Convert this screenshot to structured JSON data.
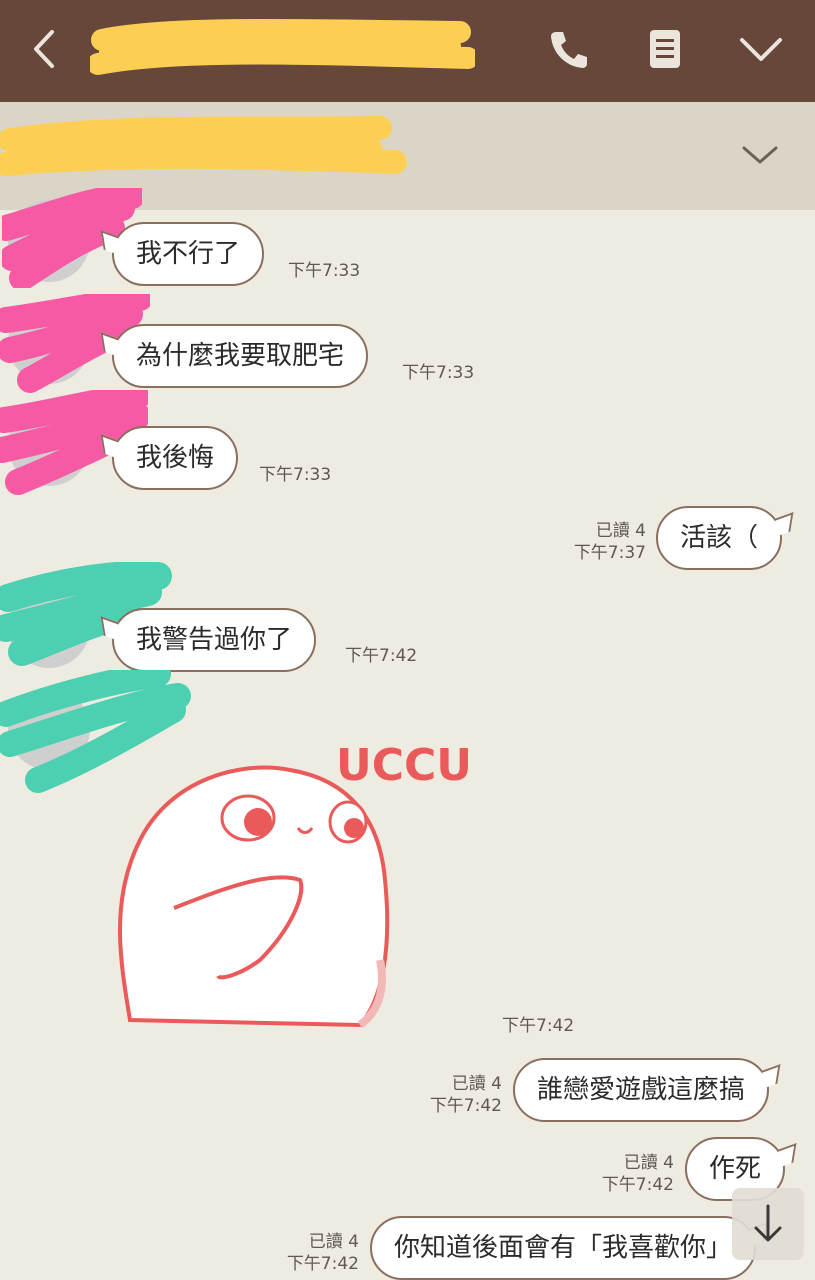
{
  "colors": {
    "header_bg": "#66473a",
    "subbar_bg": "#dbd5c8",
    "chat_bg": "#eeebe1",
    "bubble_border": "#8a6e5e",
    "redact_yellow": "#fccf54",
    "redact_pink": "#f65aa5",
    "redact_teal": "#4dcfb1"
  },
  "header": {
    "icons": [
      "back-arrow-icon",
      "phone-icon",
      "menu-icon",
      "chevron-down-icon"
    ]
  },
  "messages": [
    {
      "side": "in",
      "text": "我不行了",
      "time": "下午7:33"
    },
    {
      "side": "in",
      "text": "為什麼我要取肥宅",
      "time": "下午7:33"
    },
    {
      "side": "in",
      "text": "我後悔",
      "time": "下午7:33"
    },
    {
      "side": "out",
      "text": "活該（",
      "read": "已讀 4",
      "time": "下午7:37"
    },
    {
      "side": "in",
      "text": "我警告過你了",
      "time": "下午7:42"
    },
    {
      "side": "in",
      "sticker": "UCCU",
      "time": "下午7:42"
    },
    {
      "side": "out",
      "text": "誰戀愛遊戲這麼搞",
      "read": "已讀 4",
      "time": "下午7:42"
    },
    {
      "side": "out",
      "text": "作死",
      "read": "已讀 4",
      "time": "下午7:42"
    },
    {
      "side": "out",
      "text": "你知道後面會有「我喜歡你」",
      "read": "已讀 4",
      "time": "下午7:42"
    }
  ],
  "sticker": {
    "text": "UCCU"
  },
  "scroll_button": {
    "icon": "arrow-down-icon"
  }
}
